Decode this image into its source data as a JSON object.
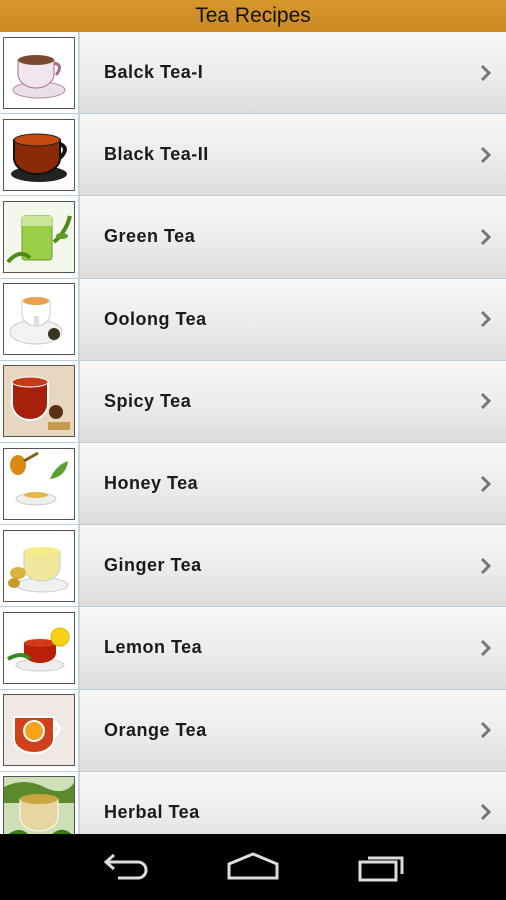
{
  "app": {
    "title": "Tea Recipes"
  },
  "items": [
    {
      "label": "Balck Tea-I",
      "icon": "black-tea-cup-image"
    },
    {
      "label": "Black Tea-II",
      "icon": "black-tea-glass-image"
    },
    {
      "label": "Green Tea",
      "icon": "green-tea-image"
    },
    {
      "label": "Oolong Tea",
      "icon": "oolong-tea-image"
    },
    {
      "label": "Spicy Tea",
      "icon": "spicy-tea-image"
    },
    {
      "label": "Honey Tea",
      "icon": "honey-tea-image"
    },
    {
      "label": "Ginger Tea",
      "icon": "ginger-tea-image"
    },
    {
      "label": "Lemon Tea",
      "icon": "lemon-tea-image"
    },
    {
      "label": "Orange Tea",
      "icon": "orange-tea-image"
    },
    {
      "label": "Herbal Tea",
      "icon": "herbal-tea-image"
    }
  ],
  "navbar": {
    "back": "back-icon",
    "home": "home-icon",
    "recents": "recent-apps-icon"
  },
  "colors": {
    "titlebar": "#d9962e",
    "row_border": "#b9cfe0",
    "chevron": "#777777"
  }
}
